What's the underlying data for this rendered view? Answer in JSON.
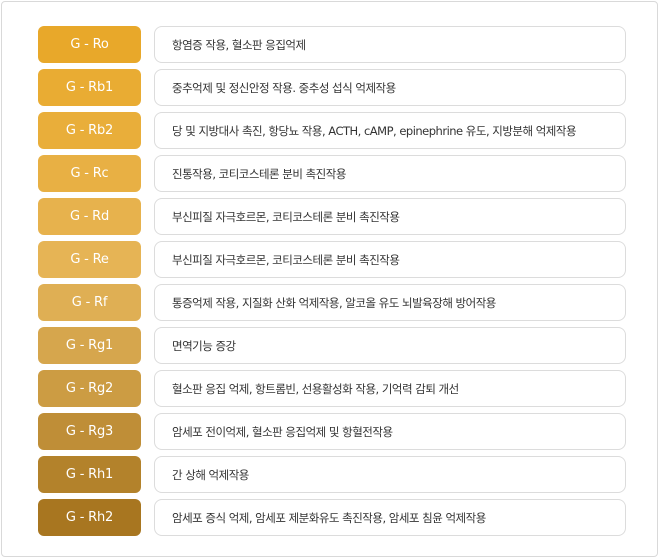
{
  "rows": [
    {
      "tag": "G - Ro",
      "desc": "항염증 작용, 혈소판 응집억제",
      "color": "#e8a82a"
    },
    {
      "tag": "G - Rb1",
      "desc": "중추억제 및 정신안정 작용. 중추성 섭식 억제작용",
      "color": "#e9ac33"
    },
    {
      "tag": "G - Rb2",
      "desc": "당 및 지방대사 촉진, 항당뇨 작용, ACTH, cAMP, epinephrine 유도, 지방분해 억제작용",
      "color": "#e9ae3a"
    },
    {
      "tag": "G - Rc",
      "desc": "진통작용, 코티코스테론 분비 촉진작용",
      "color": "#e8b044"
    },
    {
      "tag": "G - Rd",
      "desc": "부신피질 자극호르몬, 코티코스테론 분비 촉진작용",
      "color": "#e7b24d"
    },
    {
      "tag": "G - Re",
      "desc": "부신피질 자극호르몬, 코티코스테론 분비 촉진작용",
      "color": "#e6b455"
    },
    {
      "tag": "G - Rf",
      "desc": "통증억제 작용, 지질화 산화 억제작용, 알코올 유도 뇌발육장해 방어작용",
      "color": "#dfaf54"
    },
    {
      "tag": "G - Rg1",
      "desc": "면역기능 증강",
      "color": "#d6a64d"
    },
    {
      "tag": "G - Rg2",
      "desc": "혈소판 응집 억제, 항트롬빈, 선용활성화 작용, 기억력 감퇴 개선",
      "color": "#cc9c43"
    },
    {
      "tag": "G - Rg3",
      "desc": "암세포 전이억제, 혈소판 응집억제 및 항혈전작용",
      "color": "#bf8e37"
    },
    {
      "tag": "G - Rh1",
      "desc": "간 상해 억제작용",
      "color": "#b3822b"
    },
    {
      "tag": "G - Rh2",
      "desc": "암세포 증식 억제, 암세포 제분화유도 촉진작용, 암세포 침윤 억제작용",
      "color": "#a87620"
    }
  ]
}
